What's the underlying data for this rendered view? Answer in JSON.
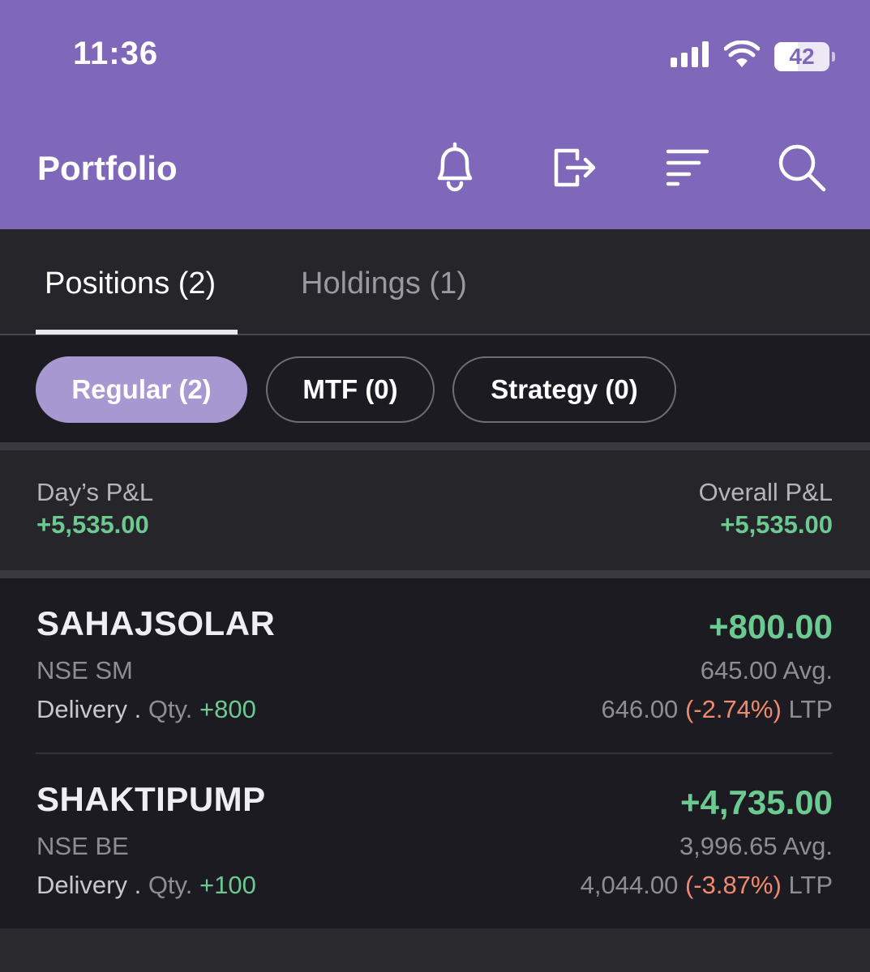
{
  "status_bar": {
    "time": "11:36",
    "battery": "42",
    "battery_level_percent": 42,
    "icons": [
      "signal-icon",
      "wifi-icon",
      "battery-icon"
    ]
  },
  "header": {
    "title": "Portfolio",
    "icons": [
      "bell-icon",
      "exit-icon",
      "sort-icon",
      "search-icon"
    ],
    "background_color": "#7f68b9"
  },
  "tabs": [
    {
      "label": "Positions (2)",
      "active": true
    },
    {
      "label": "Holdings (1)",
      "active": false
    }
  ],
  "filters": [
    {
      "label": "Regular (2)",
      "selected": true
    },
    {
      "label": "MTF (0)",
      "selected": false
    },
    {
      "label": "Strategy (0)",
      "selected": false
    }
  ],
  "summary": {
    "day_label": "Day’s P&L",
    "day_value": "+5,535.00",
    "overall_label": "Overall P&L",
    "overall_value": "+5,535.00"
  },
  "positions": [
    {
      "symbol": "SAHAJSOLAR",
      "exchange": "NSE SM",
      "product": "Delivery",
      "qty_label": "Qty.",
      "qty": "+800",
      "pnl": "+800.00",
      "avg": "645.00",
      "avg_label": "Avg.",
      "ltp": "646.00",
      "change": "(-2.74%)",
      "ltp_label": "LTP"
    },
    {
      "symbol": "SHAKTIPUMP",
      "exchange": "NSE BE",
      "product": "Delivery",
      "qty_label": "Qty.",
      "qty": "+100",
      "pnl": "+4,735.00",
      "avg": "3,996.65",
      "avg_label": "Avg.",
      "ltp": "4,044.00",
      "change": "(-3.87%)",
      "ltp_label": "LTP"
    }
  ],
  "colors": {
    "profit": "#6dc992",
    "loss": "#f08a6e",
    "accent": "#a898d2"
  }
}
